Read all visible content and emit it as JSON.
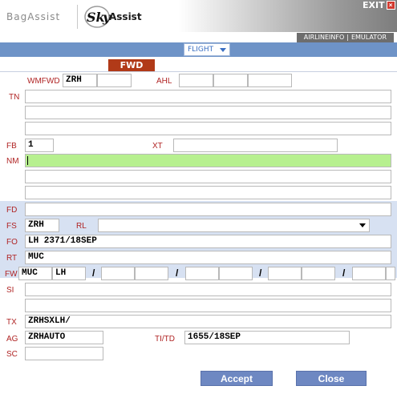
{
  "header": {
    "brand_left": "BagAssist",
    "brand_right": "Assist",
    "exit_label": "EXIT",
    "exit_icon_glyph": "×",
    "links": {
      "airlineinfo": "AIRLINEINFO",
      "emulator": "EMULATOR"
    }
  },
  "nav": {
    "flight_select": "FLIGHT"
  },
  "form": {
    "tab_label": "FWD",
    "labels": {
      "wmfwd": "WMFWD",
      "ahl": "AHL",
      "tn": "TN",
      "fb": "FB",
      "xt": "XT",
      "nm": "NM",
      "fd": "FD",
      "fs": "FS",
      "rl": "RL",
      "fo": "FO",
      "rt": "RT",
      "fw": "FW",
      "si": "SI",
      "tx": "TX",
      "ag": "AG",
      "titd": "TI/TD",
      "sc": "SC"
    },
    "values": {
      "wmfwd_station": "ZRH",
      "fb": "1",
      "fs": "ZRH",
      "fo": "LH 2371/18SEP",
      "rt": "MUC",
      "fw_station": "MUC",
      "fw_airline": "LH",
      "tx": "ZRHSXLH/",
      "ag": "ZRHAUTO",
      "titd": "1655/18SEP"
    },
    "fw_separator": "/"
  },
  "actions": {
    "accept": "Accept",
    "close": "Close"
  },
  "colors": {
    "label_red": "#b02424",
    "nav_blue": "#6e93c7",
    "section_blue": "#d7e1f2",
    "tab_red": "#b13a18",
    "button_blue": "#6e88c2",
    "active_field_green": "#b7f08f"
  }
}
